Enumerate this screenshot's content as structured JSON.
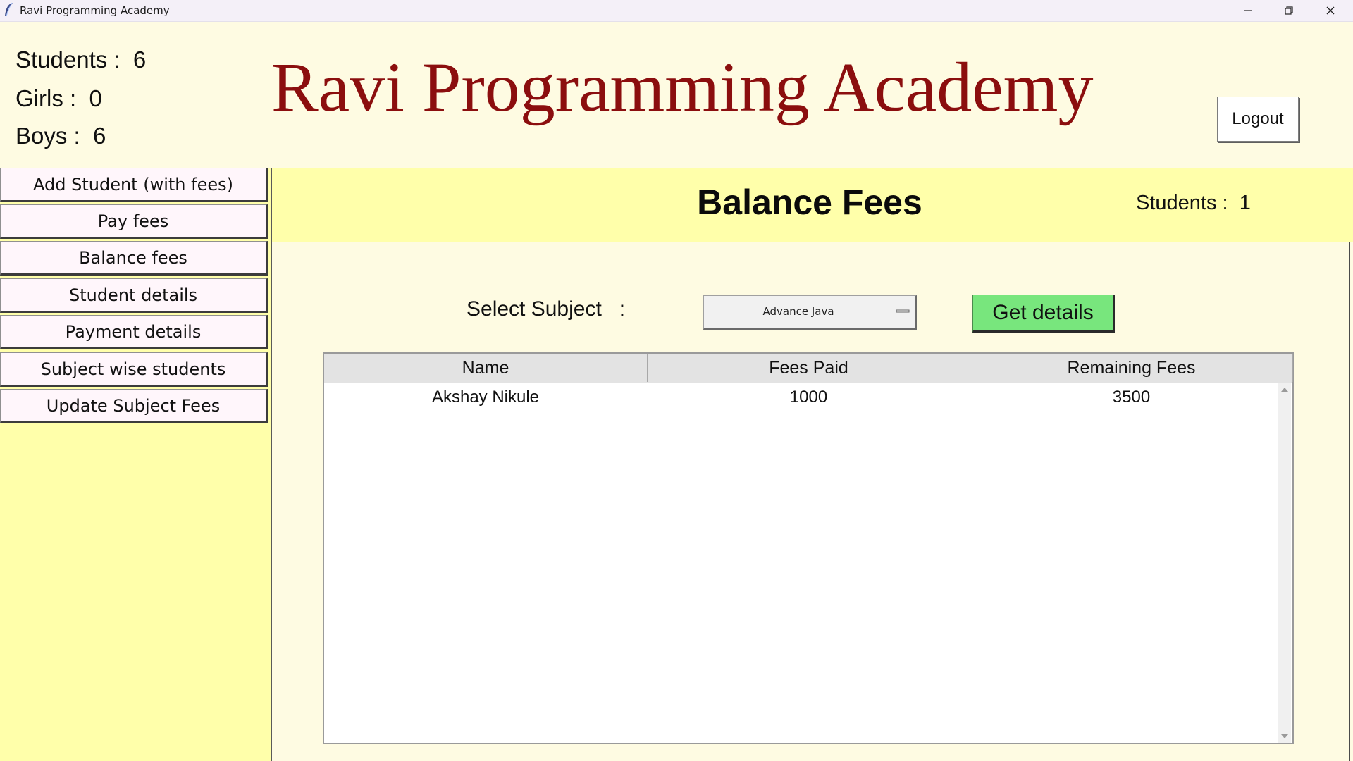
{
  "window": {
    "title": "Ravi Programming Academy",
    "controls": [
      "minimize-icon",
      "restore-icon",
      "close-icon"
    ]
  },
  "header": {
    "stats": {
      "students": "Students :  6",
      "girls": "Girls :  0",
      "boys": "Boys :  6"
    },
    "academy_title": "Ravi Programming Academy",
    "logout_label": "Logout"
  },
  "sidebar": {
    "items": [
      {
        "label": "Add Student (with fees)"
      },
      {
        "label": "Pay fees"
      },
      {
        "label": "Balance fees"
      },
      {
        "label": "Student details"
      },
      {
        "label": "Payment details"
      },
      {
        "label": "Subject wise students"
      },
      {
        "label": "Update Subject Fees"
      }
    ]
  },
  "main": {
    "title": "Balance Fees",
    "students_count": "Students :  1",
    "select_label": "Select Subject   :",
    "selected_subject": "Advance Java",
    "get_details_label": "Get details",
    "table": {
      "columns": [
        "Name",
        "Fees Paid",
        "Remaining Fees"
      ],
      "rows": [
        [
          "Akshay Nikule",
          "1000",
          "3500"
        ]
      ]
    }
  },
  "colors": {
    "title_red": "#8b0e0e",
    "sidebar_yellow": "#ffffaa",
    "page_cream": "#fefbe2",
    "button_green": "#78e67d"
  }
}
